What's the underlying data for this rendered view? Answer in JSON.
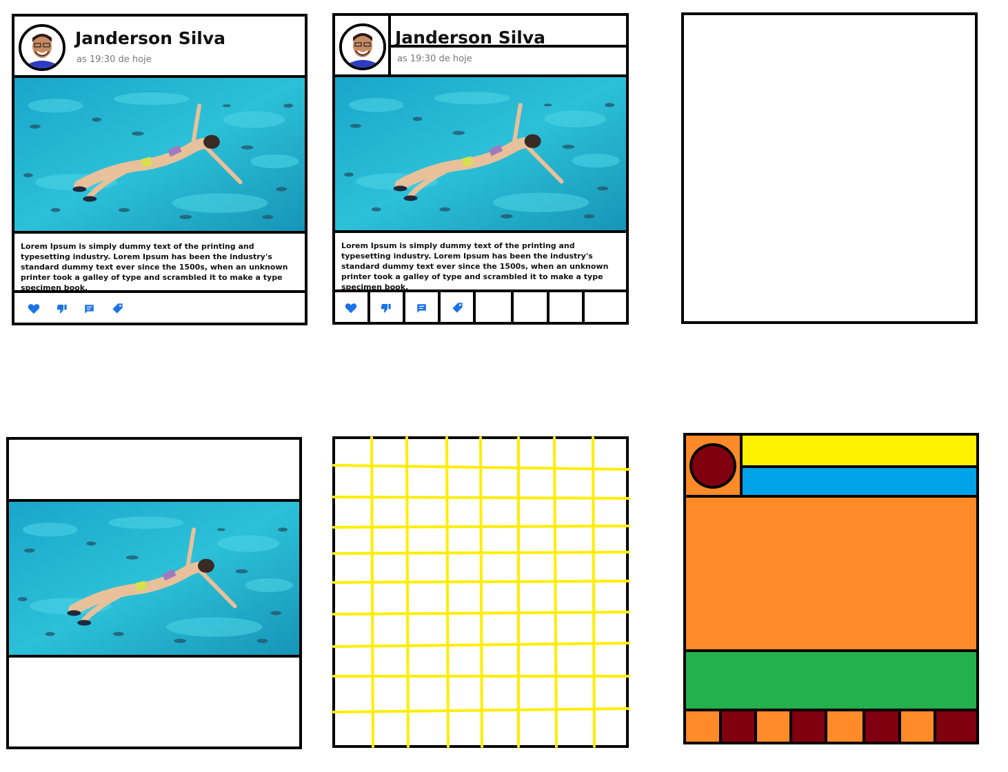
{
  "card": {
    "author_name": "Janderson Silva",
    "timestamp": "as 19:30 de hoje",
    "body": "Lorem Ipsum is simply dummy text of the printing and typesetting industry. Lorem Ipsum has been the industry's standard dummy text ever since the 1500s, when an unknown printer took a galley of type and scrambled it to make a type specimen book.",
    "actions": [
      "like-icon",
      "dislike-icon",
      "comment-icon",
      "tag-icon"
    ]
  },
  "colors": {
    "action_icon": "#1a73e8",
    "grid_line": "#ffee00",
    "avatar_region": "#ff8a28",
    "avatar_circle": "#800010",
    "name_region": "#fff200",
    "time_region": "#00a2e8",
    "image_region": "#ff8a28",
    "text_region": "#22b14c",
    "action_cell_a": "#ff8a28",
    "action_cell_b": "#800010",
    "border": "#000000"
  }
}
